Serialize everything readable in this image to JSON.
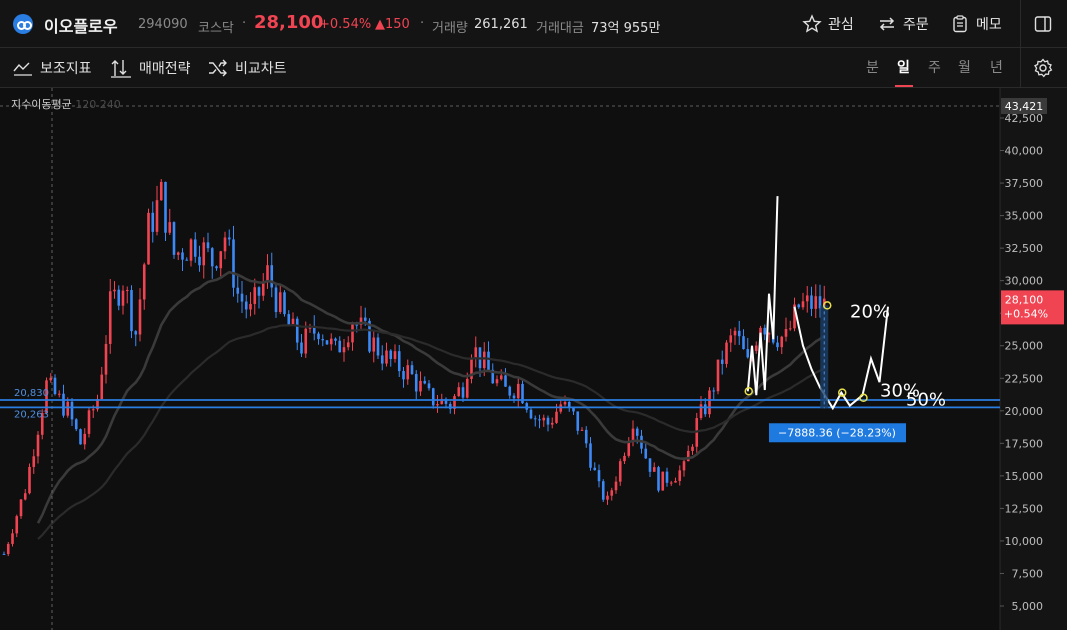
{
  "header": {
    "stock_name": "이오플로우",
    "code": "294090",
    "market": "코스닥",
    "price": "28,100",
    "change_pct": "+0.54%",
    "change_abs": "▲150",
    "volume_label": "거래량",
    "volume": "261,261",
    "amount_label": "거래대금",
    "amount": "73억 955만",
    "buttons": {
      "watch": "관심",
      "order": "주문",
      "memo": "메모"
    }
  },
  "toolbar": {
    "indicators": "보조지표",
    "strategy": "매매전략",
    "compare": "비교차트",
    "periods": [
      "분",
      "일",
      "주",
      "월",
      "년"
    ],
    "active_period": "일"
  },
  "indicator_label": {
    "name": "지수이동평균",
    "params": "120 240"
  },
  "colors": {
    "up": "#f04452",
    "down": "#3d8af7",
    "accent": "#2a7de1"
  },
  "chart_data": {
    "type": "candlestick",
    "y_ticks": [
      "42,500",
      "40,000",
      "37,500",
      "35,000",
      "32,500",
      "30,000",
      "27,500",
      "25,000",
      "22,500",
      "20,000",
      "17,500",
      "15,000",
      "12,500",
      "10,000",
      "7,500",
      "5,000"
    ],
    "ylim": [
      3500,
      44500
    ],
    "price_path": [
      [
        0,
        9000
      ],
      [
        5,
        14000
      ],
      [
        10,
        22000
      ],
      [
        15,
        20000
      ],
      [
        18,
        17500
      ],
      [
        22,
        21000
      ],
      [
        25,
        28000
      ],
      [
        28,
        30000
      ],
      [
        31,
        26000
      ],
      [
        34,
        34000
      ],
      [
        37,
        36500
      ],
      [
        40,
        32000
      ],
      [
        45,
        33000
      ],
      [
        49,
        31500
      ],
      [
        52,
        33500
      ],
      [
        55,
        29000
      ],
      [
        58,
        27500
      ],
      [
        62,
        30500
      ],
      [
        66,
        27000
      ],
      [
        70,
        25000
      ],
      [
        74,
        26500
      ],
      [
        78,
        24500
      ],
      [
        82,
        27000
      ],
      [
        86,
        25500
      ],
      [
        90,
        24000
      ],
      [
        95,
        23000
      ],
      [
        100,
        21000
      ],
      [
        105,
        20500
      ],
      [
        108,
        22000
      ],
      [
        110,
        25000
      ],
      [
        112,
        24000
      ],
      [
        115,
        22500
      ],
      [
        118,
        21500
      ],
      [
        121,
        22000
      ],
      [
        125,
        19500
      ],
      [
        128,
        19000
      ],
      [
        131,
        20500
      ],
      [
        134,
        19500
      ],
      [
        137,
        17500
      ],
      [
        140,
        14000
      ],
      [
        142,
        13000
      ],
      [
        145,
        16000
      ],
      [
        148,
        19500
      ],
      [
        151,
        16500
      ],
      [
        154,
        14500
      ],
      [
        157,
        15000
      ],
      [
        160,
        15500
      ],
      [
        163,
        19000
      ],
      [
        166,
        21000
      ],
      [
        169,
        24000
      ],
      [
        172,
        26000
      ],
      [
        175,
        23500
      ],
      [
        178,
        27000
      ],
      [
        181,
        26000
      ],
      [
        184,
        25500
      ],
      [
        187,
        28000
      ],
      [
        190,
        28200
      ],
      [
        193,
        28100
      ]
    ],
    "ema_label_values": [
      "20,830",
      "20,263"
    ],
    "reference_price": "43,421",
    "last_price_label": [
      "28,100",
      "+0.54%"
    ],
    "support_lines": [
      20830,
      20263
    ],
    "measure_label": "−7888.36 (−28.23%)",
    "annotations": [
      "20%",
      "30%",
      "50%"
    ],
    "projection_path": [
      [
        186,
        28000
      ],
      [
        188,
        25000
      ],
      [
        190,
        23200
      ],
      [
        192,
        21800
      ],
      [
        195,
        20200
      ],
      [
        197,
        21400
      ],
      [
        199,
        20400
      ],
      [
        202,
        21200
      ],
      [
        204,
        24000
      ],
      [
        206,
        22200
      ],
      [
        208,
        28000
      ]
    ],
    "past_wave_path": [
      [
        175,
        21500
      ],
      [
        176,
        25000
      ],
      [
        177,
        21200
      ],
      [
        178,
        26000
      ],
      [
        179,
        21600
      ],
      [
        180,
        29000
      ],
      [
        181,
        25500
      ],
      [
        182,
        36500
      ]
    ]
  }
}
